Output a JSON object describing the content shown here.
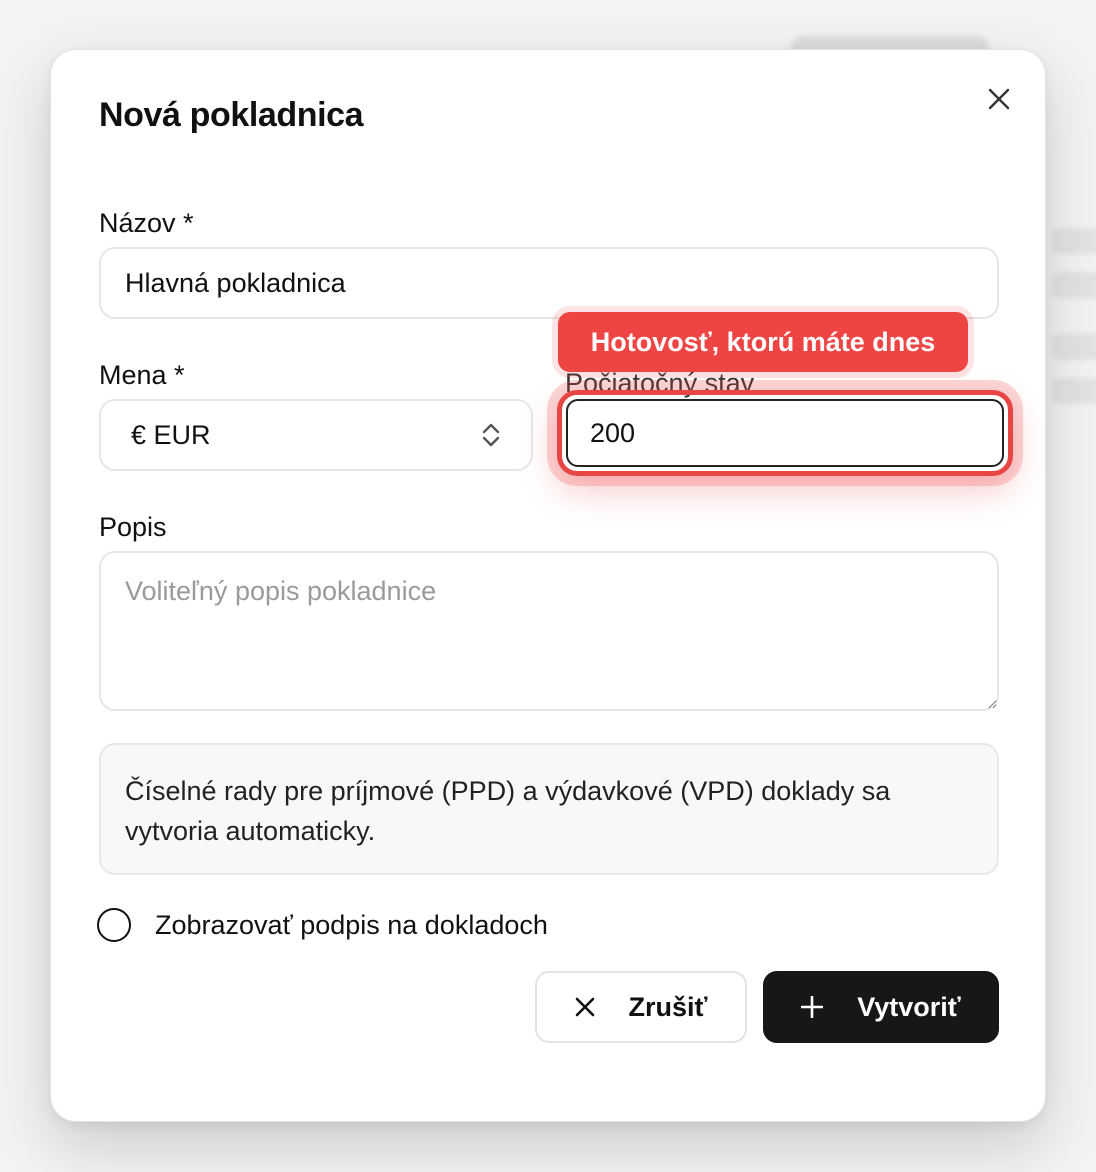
{
  "dialog": {
    "title": "Nová pokladnica",
    "close_icon": "close-icon"
  },
  "form": {
    "name": {
      "label": "Názov *",
      "value": "Hlavná pokladnica"
    },
    "currency": {
      "label": "Mena *",
      "value": "€ EUR",
      "icon": "chevron-up-down-icon"
    },
    "opening_balance": {
      "label": "Počiatočný stav",
      "value": "200"
    },
    "description": {
      "label": "Popis",
      "placeholder": "Voliteľný popis pokladnice",
      "value": ""
    },
    "info_text": "Číselné rady pre príjmové (PPD) a výdavkové (VPD) doklady sa vytvoria automaticky.",
    "show_signature": {
      "label": "Zobrazovať podpis na dokladoch",
      "checked": false
    }
  },
  "tooltip": {
    "text": "Hotovosť, ktorú máte dnes"
  },
  "buttons": {
    "cancel": {
      "label": "Zrušiť",
      "icon": "close-icon"
    },
    "create": {
      "label": "Vytvoriť",
      "icon": "plus-icon"
    }
  },
  "colors": {
    "accent_red": "#ef4444",
    "primary_dark": "#171717",
    "border": "#e6e6e6"
  }
}
